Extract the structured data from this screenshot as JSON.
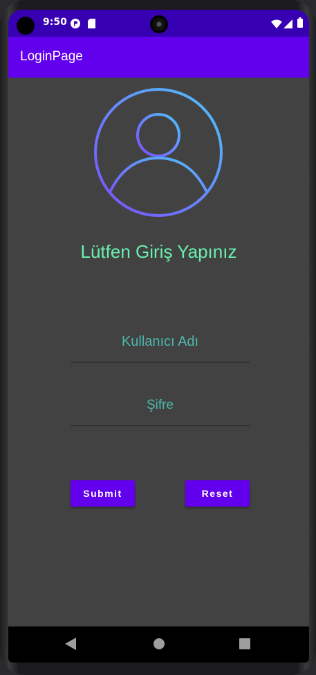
{
  "status_bar": {
    "time": "9:50",
    "icons": [
      "notification-p-icon",
      "sd-card-icon",
      "wifi-icon",
      "signal-icon",
      "battery-icon"
    ]
  },
  "app_bar": {
    "title": "LoginPage"
  },
  "login": {
    "greeting": "Lütfen Giriş Yapınız",
    "username_placeholder": "Kullanıcı Adı",
    "password_placeholder": "Şifre",
    "submit_label": "Submit",
    "reset_label": "Reset"
  },
  "nav_bar": {
    "icons": [
      "back-icon",
      "home-icon",
      "recents-icon"
    ]
  },
  "colors": {
    "status_bar": "#3700b3",
    "primary": "#6200ee",
    "background": "#424242",
    "greeting_text": "#69f0ae",
    "field_text": "#4db6ac",
    "avatar_gradient": [
      "#4fc3f7",
      "#7c4dff"
    ]
  }
}
